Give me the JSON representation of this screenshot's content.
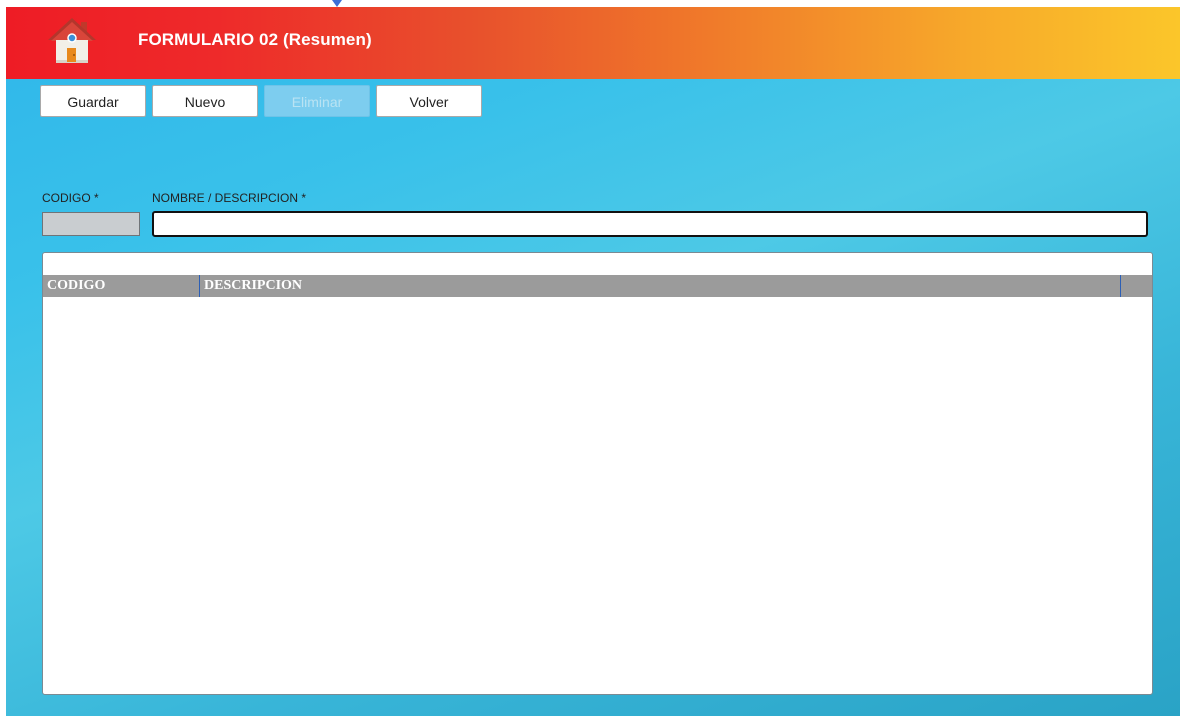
{
  "header": {
    "title": "FORMULARIO 02 (Resumen)",
    "icon": "home-icon",
    "gradient_start": "#ee1c25",
    "gradient_end": "#fbc62a"
  },
  "toolbar": {
    "save_label": "Guardar",
    "new_label": "Nuevo",
    "delete_label": "Eliminar",
    "delete_enabled": false,
    "back_label": "Volver"
  },
  "form": {
    "codigo_label": "CODIGO *",
    "codigo_value": "",
    "nombre_label": "NOMBRE / DESCRIPCION *",
    "nombre_value": ""
  },
  "grid": {
    "columns": [
      "CODIGO",
      "DESCRIPCION"
    ],
    "rows": []
  },
  "colors": {
    "background": "#2fb6ea",
    "grid_header": "#9b9b9b",
    "column_divider": "#2c5fb5"
  }
}
